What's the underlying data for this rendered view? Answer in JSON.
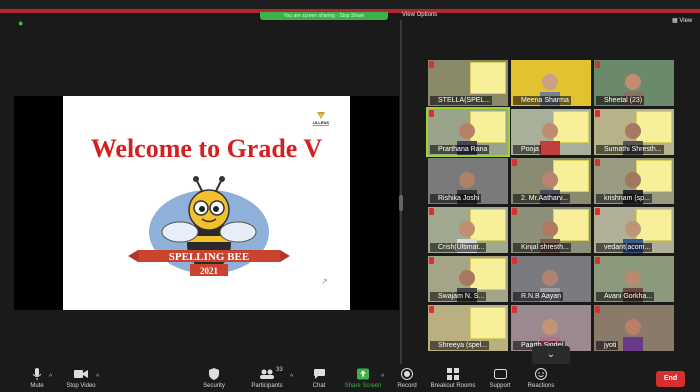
{
  "top_bar": {
    "share_banner": "You are screen sharing · Stop Share",
    "view_options": "View Options",
    "view_button": "View"
  },
  "slide": {
    "title": "Welcome to Grade V",
    "logo_text": "ULLENS",
    "banner_line1": "SPELLING BEE",
    "banner_line2": "2021"
  },
  "gallery": {
    "participants": [
      {
        "name": "STELLA(SPEL..."
      },
      {
        "name": "Meena Sharma"
      },
      {
        "name": "Sheetal (23)"
      },
      {
        "name": "Prarthana Rana"
      },
      {
        "name": "Pooja"
      },
      {
        "name": "Sumathi Shresth..."
      },
      {
        "name": "Rishika Joshi"
      },
      {
        "name": "2. Mr.Aatharv..."
      },
      {
        "name": "krishnam (sp..."
      },
      {
        "name": "Crish(Ultimat..."
      },
      {
        "name": "Kinjal shresth..."
      },
      {
        "name": "vedant(acom..."
      },
      {
        "name": "Swajam N. S..."
      },
      {
        "name": "R.N.B Aayan"
      },
      {
        "name": "Avani Gorkha..."
      },
      {
        "name": "Shreeya (spel..."
      },
      {
        "name": "Paarth Sigdel"
      },
      {
        "name": "jyoti"
      }
    ]
  },
  "toolbar": {
    "mute": "Mute",
    "stop_video": "Stop Video",
    "security": "Security",
    "participants": "Participants",
    "participants_count": "33",
    "chat": "Chat",
    "share_screen": "Share Screen",
    "record": "Record",
    "breakout_rooms": "Breakout Rooms",
    "support": "Support",
    "reactions": "Reactions",
    "end": "End"
  },
  "colors": {
    "accent_green": "#3ab34a",
    "end_red": "#d52f2f",
    "title_red": "#d42020"
  }
}
